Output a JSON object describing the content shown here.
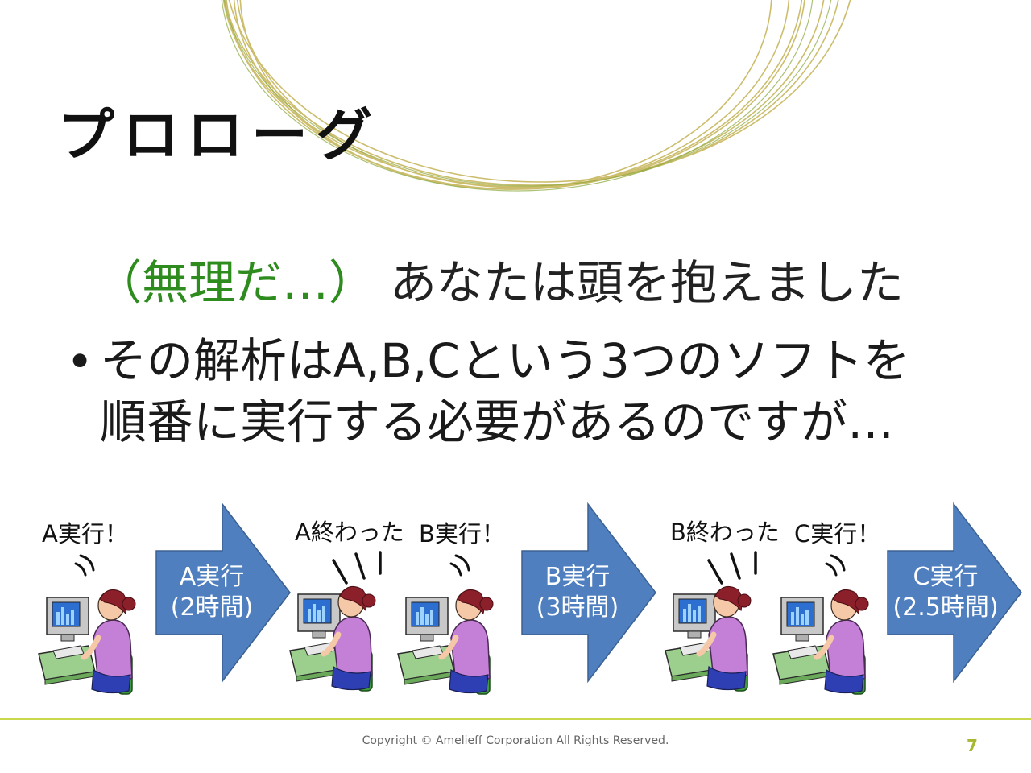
{
  "slide": {
    "title": "プロローグ",
    "line1_green": "（無理だ…）",
    "line1_text": "あなたは頭を抱えました",
    "bullet": "•",
    "bullet_line1": "その解析はA,B,Cという3つのソフトを",
    "bullet_line2": "順番に実行する必要があるのですが…"
  },
  "diagram": {
    "labels": {
      "a_run": "A実行！",
      "a_done": "A終わった",
      "b_run": "B実行！",
      "b_done": "B終わった",
      "c_run": "C実行！"
    },
    "arrows": [
      {
        "line1": "A実行",
        "line2": "(2時間)"
      },
      {
        "line1": "B実行",
        "line2": "(3時間)"
      },
      {
        "line1": "C実行",
        "line2": "(2.5時間)"
      }
    ],
    "arrow_color": "#4f7fbe",
    "figure_colors": {
      "shirt": "#c47fd6",
      "hair": "#8b1f2a",
      "chair": "#3e9a3a",
      "monitor": "#bfbfbf",
      "screen": "#2d6fd1"
    }
  },
  "footer": {
    "copyright": "Copyright © Amelieff Corporation All Rights Reserved.",
    "page_number": "7"
  }
}
